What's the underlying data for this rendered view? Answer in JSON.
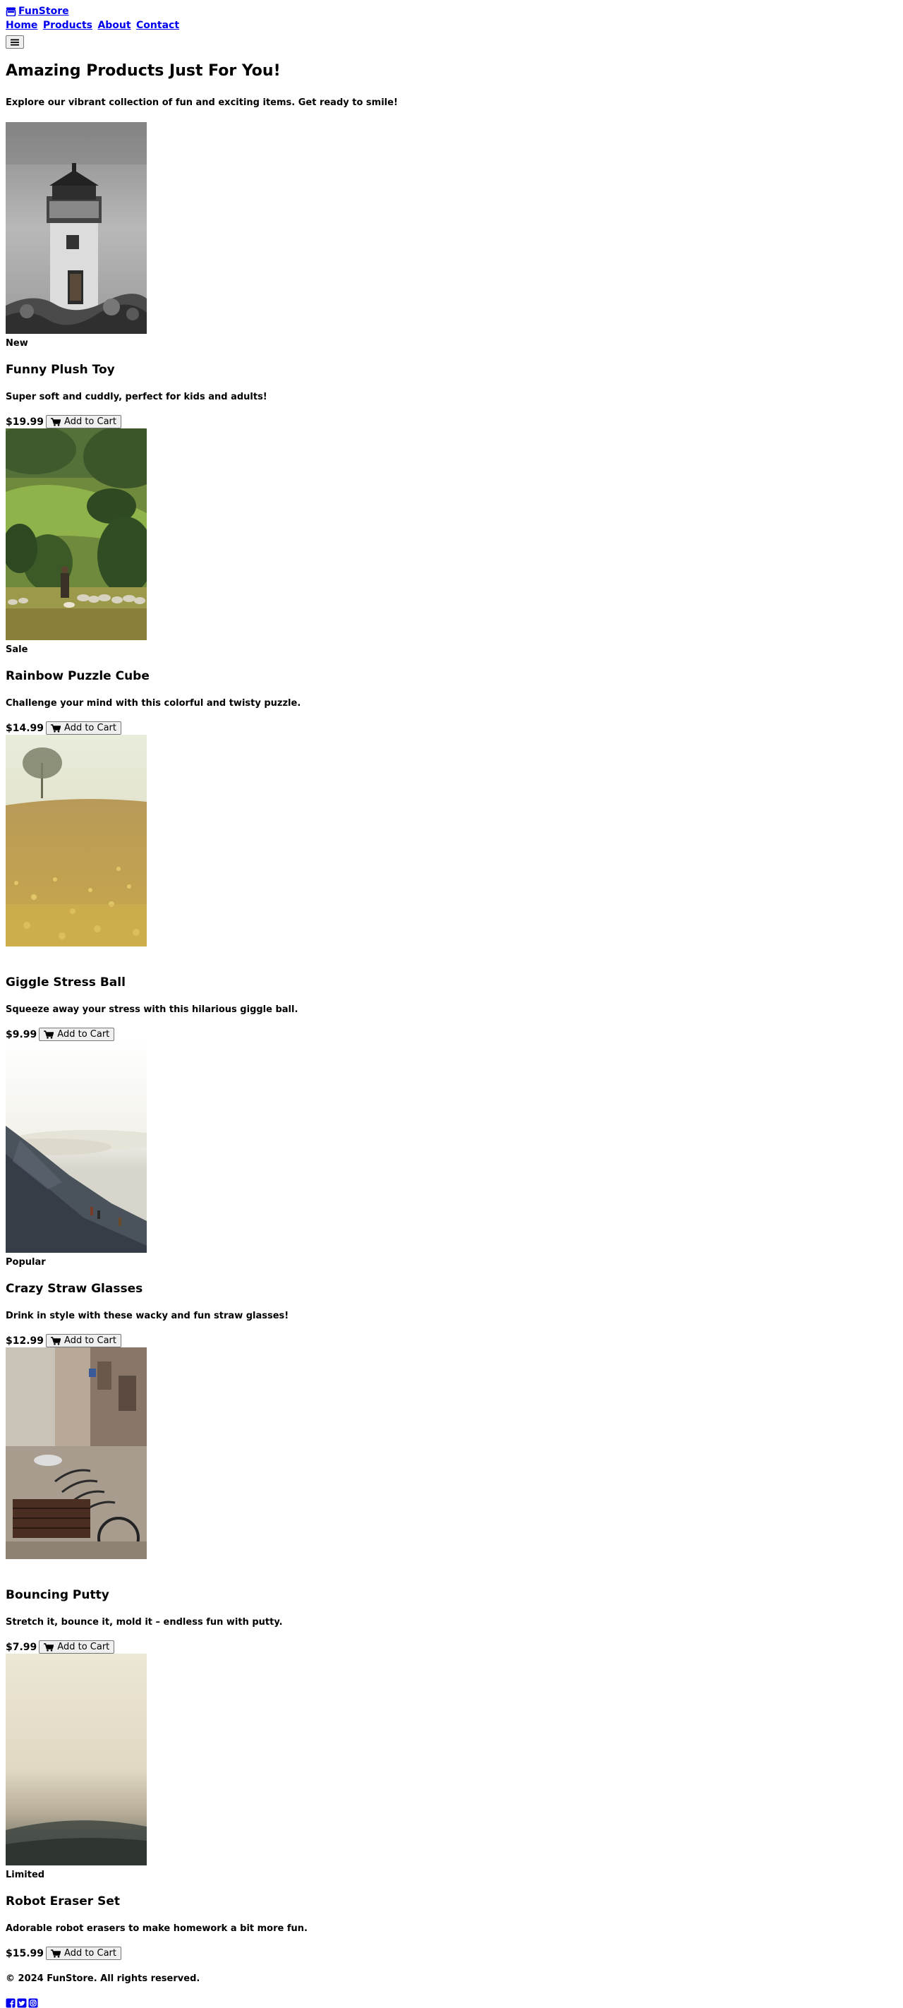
{
  "header": {
    "brand_name": "FunStore",
    "brand_icon": "store-icon",
    "nav": [
      "Home",
      "Products",
      "About",
      "Contact"
    ],
    "menu_icon": "hamburger-icon"
  },
  "hero": {
    "title": "Amazing Products Just For You!",
    "subtitle": "Explore our vibrant collection of fun and exciting items. Get ready to smile!"
  },
  "products": [
    {
      "badge": "New",
      "name": "Funny Plush Toy",
      "description": "Super soft and cuddly, perfect for kids and adults!",
      "price": "$19.99",
      "button": "Add to Cart",
      "image": "lighthouse"
    },
    {
      "badge": "Sale",
      "name": "Rainbow Puzzle Cube",
      "description": "Challenge your mind with this colorful and twisty puzzle.",
      "price": "$14.99",
      "button": "Add to Cart",
      "image": "shepherd-hills"
    },
    {
      "badge": "",
      "name": "Giggle Stress Ball",
      "description": "Squeeze away your stress with this hilarious giggle ball.",
      "price": "$9.99",
      "button": "Add to Cart",
      "image": "field-tree"
    },
    {
      "badge": "Popular",
      "name": "Crazy Straw Glasses",
      "description": "Drink in style with these wacky and fun straw glasses!",
      "price": "$12.99",
      "button": "Add to Cart",
      "image": "mountain-clouds"
    },
    {
      "badge": "",
      "name": "Bouncing Putty",
      "description": "Stretch it, bounce it, mold it – endless fun with putty.",
      "price": "$7.99",
      "button": "Add to Cart",
      "image": "street-bicycles"
    },
    {
      "badge": "Limited",
      "name": "Robot Eraser Set",
      "description": "Adorable robot erasers to make homework a bit more fun.",
      "price": "$15.99",
      "button": "Add to Cart",
      "image": "foggy-hill"
    }
  ],
  "footer": {
    "copyright": "© 2024 FunStore. All rights reserved.",
    "social": [
      "facebook-icon",
      "twitter-icon",
      "instagram-icon"
    ]
  },
  "colors": {
    "link": "#0000ee",
    "text": "#000000",
    "button_bg": "#efefef",
    "button_border": "#767676"
  }
}
